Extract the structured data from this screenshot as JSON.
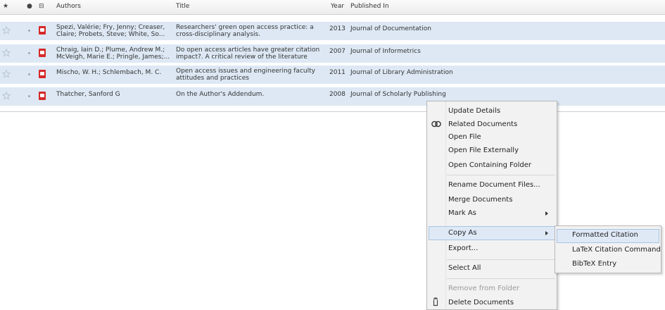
{
  "columns": {
    "star": "★",
    "read": "●",
    "attach": "⊟",
    "authors": "Authors",
    "title": "Title",
    "year": "Year",
    "published": "Published In"
  },
  "rows": [
    {
      "authors": [
        "Spezi, Valérie; Fry, Jenny; Creaser,",
        "Claire; Probets, Steve; White, So..."
      ],
      "title": [
        "Researchers' green open access practice: a",
        "cross-disciplinary analysis."
      ],
      "year": "2013",
      "published": "Journal of Documentation"
    },
    {
      "authors": [
        "Chraig, Iain D.; Plume, Andrew M.;",
        "McVeigh, Marie E.; Pringle, James;..."
      ],
      "title": [
        "Do open access articles have greater citation",
        "impact?. A critical review of the literature"
      ],
      "year": "2007",
      "published": "Journal of Informetrics"
    },
    {
      "authors": [
        "Mischo, W. H.; Schlembach, M. C.",
        ""
      ],
      "title": [
        "Open access issues and engineering faculty",
        "attitudes and practices"
      ],
      "year": "2011",
      "published": "Journal of Library Administration"
    },
    {
      "authors": [
        "Thatcher, Sanford G",
        ""
      ],
      "title": [
        "On the Author's Addendum.",
        ""
      ],
      "year": "2008",
      "published": "Journal of Scholarly Publishing"
    }
  ],
  "context_menu": {
    "update_details": "Update Details",
    "related_documents": "Related Documents",
    "open_file": "Open File",
    "open_file_externally": "Open File Externally",
    "open_containing_folder": "Open Containing Folder",
    "rename_document_files": "Rename Document Files...",
    "merge_documents": "Merge Documents",
    "mark_as": "Mark As",
    "copy_as": "Copy As",
    "export": "Export...",
    "select_all": "Select All",
    "remove_from_folder": "Remove from Folder",
    "delete_documents": "Delete Documents"
  },
  "submenu": {
    "formatted_citation": "Formatted Citation",
    "latex_citation_command": "LaTeX Citation Command",
    "bibtex_entry": "BibTeX Entry"
  },
  "colors": {
    "row_selected": "#dde8f4",
    "pdf_icon": "#d62a2a",
    "menu_bg": "#f2f2f2",
    "menu_highlight": "#dfe9f6"
  }
}
